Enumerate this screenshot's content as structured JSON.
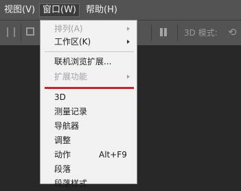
{
  "menubar": {
    "items": [
      {
        "label": "视图(V)"
      },
      {
        "label": "窗口(W)"
      },
      {
        "label": "帮助(H)"
      }
    ]
  },
  "toolbar": {
    "mode_label": "3D 模式:"
  },
  "window_menu": {
    "items": [
      {
        "label": "排列(A)",
        "disabled": true,
        "submenu": true
      },
      {
        "label": "工作区(K)",
        "disabled": false,
        "submenu": true
      },
      {
        "label": "联机浏览扩展...",
        "disabled": false
      },
      {
        "label": "扩展功能",
        "disabled": true,
        "submenu": true
      },
      {
        "label": "3D"
      },
      {
        "label": "测量记录"
      },
      {
        "label": "导航器"
      },
      {
        "label": "调整"
      },
      {
        "label": "动作",
        "shortcut": "Alt+F9"
      },
      {
        "label": "段落"
      },
      {
        "label": "段落样式"
      }
    ],
    "highlight_color": "#cc2222"
  }
}
